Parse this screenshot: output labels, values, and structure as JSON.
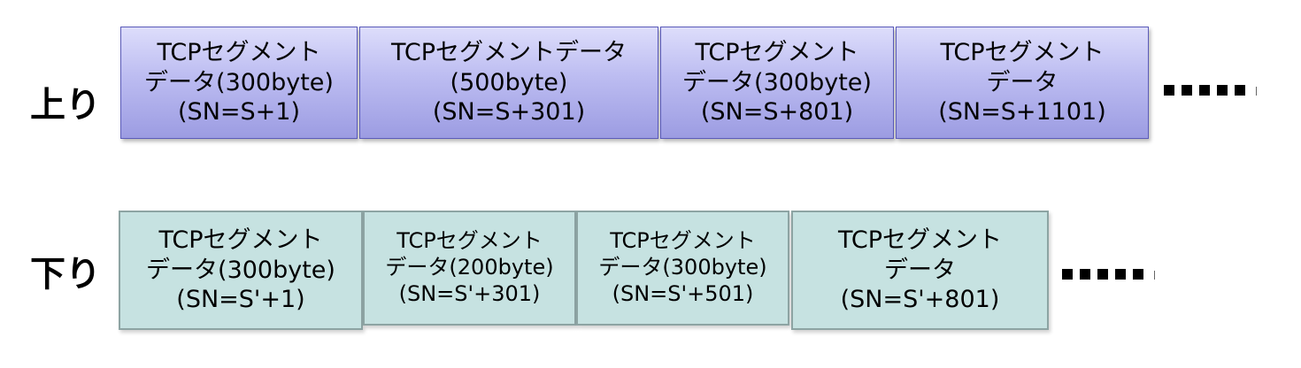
{
  "upstream": {
    "label": "上り",
    "segments": [
      {
        "lines": [
          "TCPセグメント",
          "データ(300byte)",
          "(SN=S+1)"
        ]
      },
      {
        "lines": [
          "TCPセグメントデータ",
          "(500byte)",
          "(SN=S+301)"
        ]
      },
      {
        "lines": [
          "TCPセグメント",
          "データ(300byte)",
          "(SN=S+801)"
        ]
      },
      {
        "lines": [
          "TCPセグメント",
          "データ",
          "(SN=S+1101)"
        ]
      }
    ],
    "ellipsis": "……"
  },
  "downstream": {
    "label": "下り",
    "segments": [
      {
        "lines": [
          "TCPセグメント",
          "データ(300byte)",
          "(SN=S'+1)"
        ]
      },
      {
        "lines": [
          "TCPセグメント",
          "データ(200byte)",
          "(SN=S'+301)"
        ]
      },
      {
        "lines": [
          "TCPセグメント",
          "データ(300byte)",
          "(SN=S'+501)"
        ]
      },
      {
        "lines": [
          "TCPセグメント",
          "データ",
          "(SN=S'+801)"
        ]
      }
    ],
    "ellipsis": "……"
  }
}
